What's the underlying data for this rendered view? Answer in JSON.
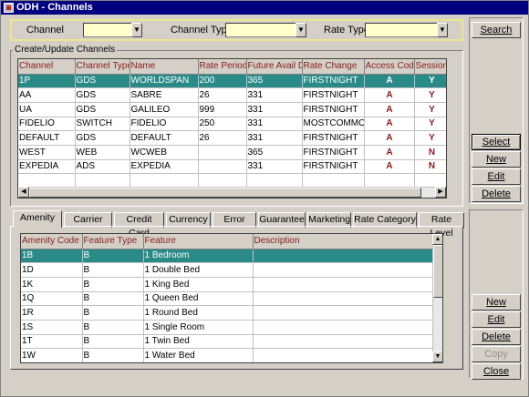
{
  "window": {
    "title": "ODH - Channels"
  },
  "filters": {
    "channel_label": "Channel",
    "channel_value": "",
    "channel_type_label": "Channel Type",
    "channel_type_value": "",
    "rate_type_label": "Rate Type",
    "rate_type_value": ""
  },
  "buttons": {
    "search": "Search",
    "select": "Select",
    "new_top": "New",
    "edit_top": "Edit",
    "delete_top": "Delete",
    "new_bottom": "New",
    "edit_bottom": "Edit",
    "delete_bottom": "Delete",
    "copy": "Copy",
    "close": "Close"
  },
  "channels": {
    "group_label": "Create/Update Channels",
    "columns": [
      "Channel",
      "Channel Type",
      "Name",
      "Rate Periods",
      "Future Avail Da",
      "Rate Change",
      "Access Code",
      "Session"
    ],
    "rows": [
      [
        "1P",
        "GDS",
        "WORLDSPAN",
        "200",
        "365",
        "FIRSTNIGHT",
        "A",
        "Y"
      ],
      [
        "AA",
        "GDS",
        "SABRE",
        "26",
        "331",
        "FIRSTNIGHT",
        "A",
        "Y"
      ],
      [
        "UA",
        "GDS",
        "GALILEO",
        "999",
        "331",
        "FIRSTNIGHT",
        "A",
        "Y"
      ],
      [
        "FIDELIO",
        "SWITCH",
        "FIDELIO",
        "250",
        "331",
        "MOSTCOMMONI",
        "A",
        "Y"
      ],
      [
        "DEFAULT",
        "GDS",
        "DEFAULT",
        "26",
        "331",
        "FIRSTNIGHT",
        "A",
        "Y"
      ],
      [
        "WEST",
        "WEB",
        "WCWEB",
        "",
        "365",
        "FIRSTNIGHT",
        "A",
        "N"
      ],
      [
        "EXPEDIA",
        "ADS",
        "EXPEDIA",
        "",
        "331",
        "FIRSTNIGHT",
        "A",
        "N"
      ],
      [
        "",
        "",
        "",
        "",
        "",
        "",
        "",
        ""
      ]
    ]
  },
  "tabs": [
    "Amenity",
    "Carrier",
    "Credit Card",
    "Currency",
    "Error",
    "Guarantee",
    "Marketing",
    "Rate Category",
    "Rate Level"
  ],
  "amenities": {
    "columns": [
      "Amenity Code",
      "Feature Type",
      "Feature",
      "Description"
    ],
    "rows": [
      [
        "1B",
        "B",
        "1 Bedroom",
        ""
      ],
      [
        "1D",
        "B",
        "1 Double Bed",
        ""
      ],
      [
        "1K",
        "B",
        "1 King Bed",
        ""
      ],
      [
        "1Q",
        "B",
        "1 Queen Bed",
        ""
      ],
      [
        "1R",
        "B",
        "1 Round Bed",
        ""
      ],
      [
        "1S",
        "B",
        "1 Single Room",
        ""
      ],
      [
        "1T",
        "B",
        "1 Twin Bed",
        ""
      ],
      [
        "1W",
        "B",
        "1 Water Bed",
        ""
      ]
    ]
  },
  "colors": {
    "titlebar": "#000080",
    "selection": "#2a8a88",
    "header_text": "#8a1a1a",
    "filter_field": "#ffffcc"
  }
}
